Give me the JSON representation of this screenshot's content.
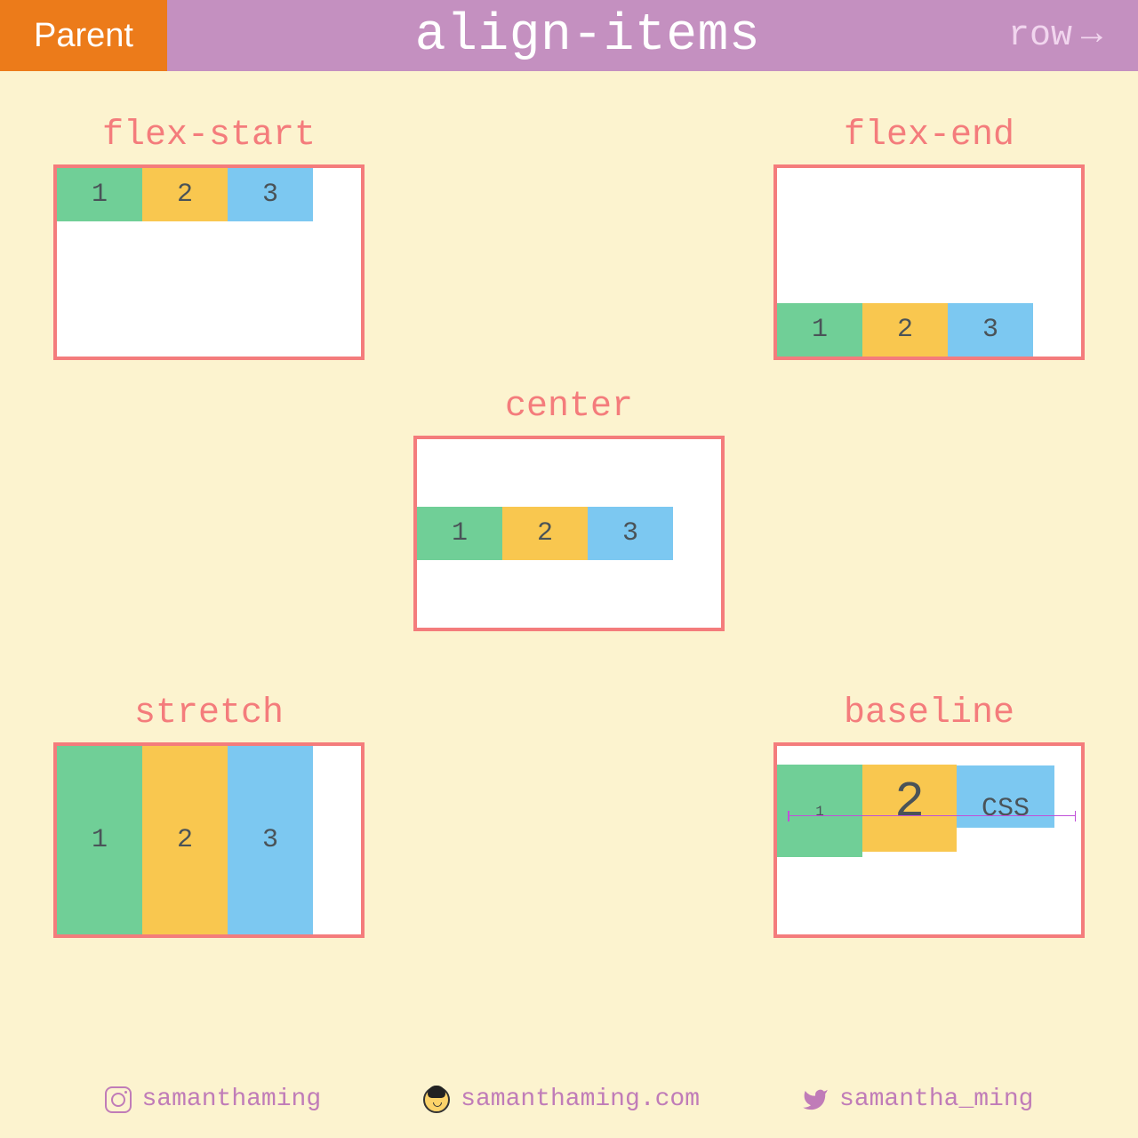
{
  "header": {
    "badge": "Parent",
    "title": "align-items",
    "direction": "row",
    "arrow": "→"
  },
  "examples": {
    "flex_start": {
      "title": "flex-start",
      "items": [
        "1",
        "2",
        "3"
      ]
    },
    "flex_end": {
      "title": "flex-end",
      "items": [
        "1",
        "2",
        "3"
      ]
    },
    "center": {
      "title": "center",
      "items": [
        "1",
        "2",
        "3"
      ]
    },
    "stretch": {
      "title": "stretch",
      "items": [
        "1",
        "2",
        "3"
      ]
    },
    "baseline": {
      "title": "baseline",
      "items": [
        "1",
        "2",
        "CSS"
      ]
    }
  },
  "footer": {
    "instagram": "samanthaming",
    "website": "samanthaming.com",
    "twitter": "samantha_ming"
  },
  "colors": {
    "bg": "#fcf3cf",
    "header_bg": "#c490c0",
    "badge_bg": "#ec7b1a",
    "accent": "#f47c7c",
    "box_green": "#70cf97",
    "box_yellow": "#f9c74f",
    "box_blue": "#7cc8f1"
  }
}
